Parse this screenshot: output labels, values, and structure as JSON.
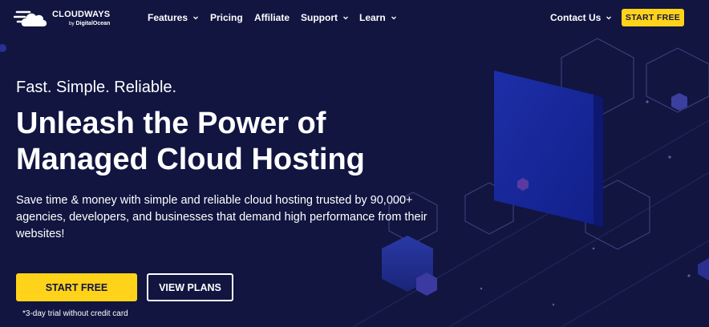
{
  "brand": {
    "name": "CLOUDWAYS",
    "by": "by",
    "parent": "DigitalOcean"
  },
  "nav": {
    "items": [
      {
        "label": "Features",
        "dropdown": true
      },
      {
        "label": "Pricing",
        "dropdown": false
      },
      {
        "label": "Affiliate",
        "dropdown": false
      },
      {
        "label": "Support",
        "dropdown": true
      },
      {
        "label": "Learn",
        "dropdown": true
      }
    ],
    "contact": "Contact Us",
    "cta": "START FREE"
  },
  "hero": {
    "tagline": "Fast. Simple. Reliable.",
    "headline_line1": "Unleash the Power of",
    "headline_line2": "Managed Cloud Hosting",
    "subtext": "Save time & money with simple and reliable cloud hosting trusted by 90,000+ agencies, developers, and businesses that demand high performance from their websites!",
    "primary_button": "START FREE",
    "secondary_button": "VIEW PLANS",
    "note": "*3-day trial without credit card"
  },
  "colors": {
    "background": "#111540",
    "accent": "#ffd31a",
    "text": "#ffffff"
  },
  "icons": [
    "cloud-logo-icon",
    "chevron-down-icon"
  ]
}
